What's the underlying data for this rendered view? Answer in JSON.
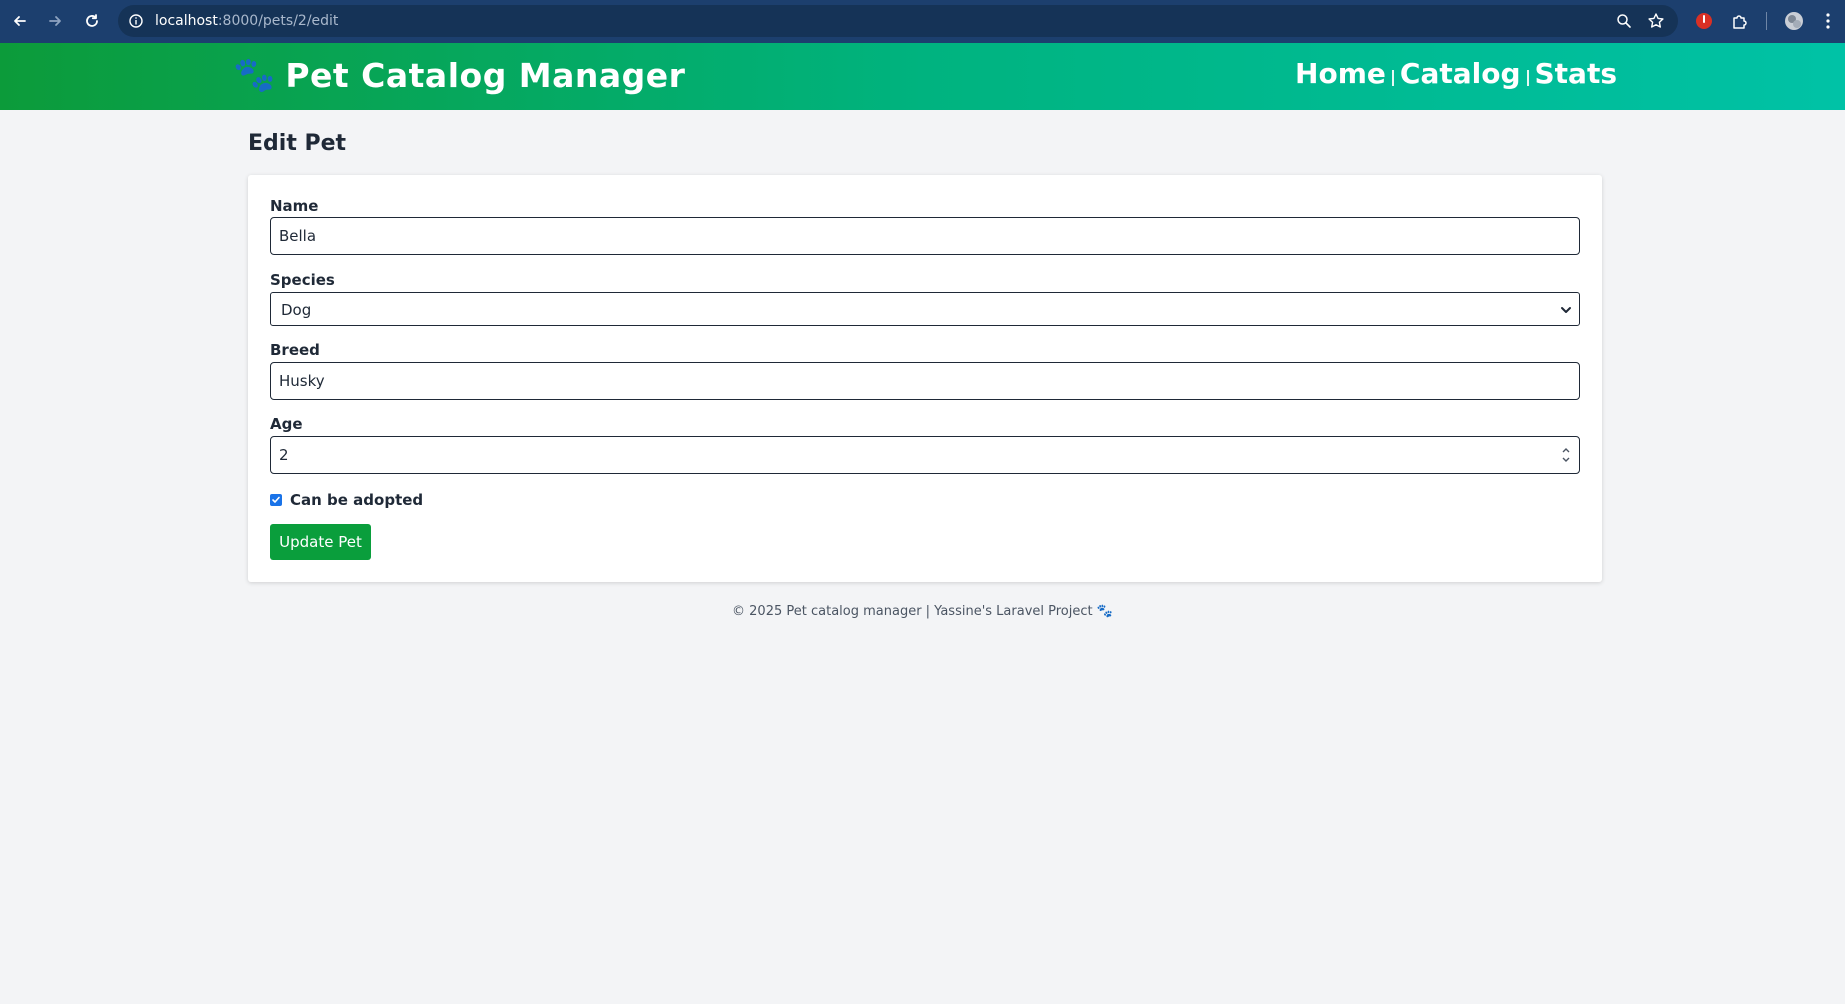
{
  "browser": {
    "url_host": "localhost",
    "url_path": ":8000/pets/2/edit"
  },
  "header": {
    "brand_icon": "🐾",
    "brand_title": "Pet Catalog Manager",
    "nav": [
      "Home",
      "Catalog",
      "Stats"
    ]
  },
  "page": {
    "title": "Edit Pet"
  },
  "form": {
    "name_label": "Name",
    "name_value": "Bella",
    "species_label": "Species",
    "species_value": "Dog",
    "breed_label": "Breed",
    "breed_value": "Husky",
    "age_label": "Age",
    "age_value": "2",
    "adoptable_label": "Can be adopted",
    "adoptable_checked": true,
    "submit_label": "Update Pet"
  },
  "footer": {
    "text": "© 2025 Pet catalog manager | Yassine's Laravel Project",
    "icon": "🐾"
  },
  "colors": {
    "header_gradient_start": "#0c9b3a",
    "header_gradient_end": "#00c2a6",
    "button": "#0a9e3c",
    "page_bg": "#f3f4f6"
  }
}
